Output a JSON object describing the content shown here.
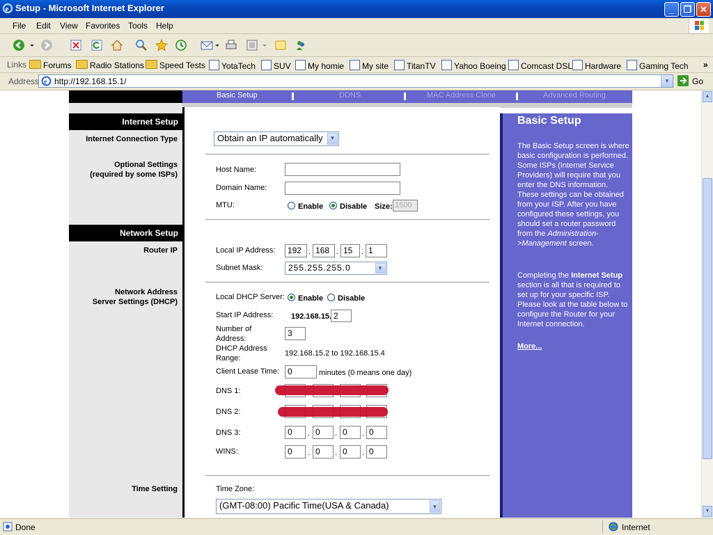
{
  "window": {
    "title": "Setup - Microsoft Internet Explorer"
  },
  "menu": [
    "File",
    "Edit",
    "View",
    "Favorites",
    "Tools",
    "Help"
  ],
  "links_bar": {
    "label": "Links",
    "items": [
      "Forums",
      "Radio Stations",
      "Speed Tests",
      "YotaTech",
      "SUV",
      "My homie",
      "My site",
      "TitanTV",
      "Yahoo Boeing",
      "Comcast DSL",
      "Hardware",
      "Gaming Tech"
    ]
  },
  "address": {
    "label": "Address",
    "url": "http://192.168.15.1/",
    "go": "Go"
  },
  "nav": {
    "basic": "Basic Setup",
    "ddns": "DDNS",
    "mac": "MAC Address Clone",
    "routing": "Advanced Routing"
  },
  "internet_setup": {
    "heading": "Internet Setup",
    "conn_type_label": "Internet Connection Type",
    "conn_type_value": "Obtain an IP automatically",
    "optional_label_1": "Optional Settings",
    "optional_label_2": "(required by some ISPs)",
    "host_name_label": "Host Name:",
    "host_name_value": "",
    "domain_name_label": "Domain Name:",
    "domain_name_value": "",
    "mtu_label": "MTU:",
    "mtu_enable": "Enable",
    "mtu_disable": "Disable",
    "mtu_size_label": "Size:",
    "mtu_size_value": "1500"
  },
  "network_setup": {
    "heading": "Network Setup",
    "router_ip_label": "Router IP",
    "local_ip_label": "Local IP Address:",
    "local_ip": [
      "192",
      "168",
      "15",
      "1"
    ],
    "subnet_label": "Subnet Mask:",
    "subnet_value": "255.255.255.0",
    "dhcp_label_1": "Network Address",
    "dhcp_label_2": "Server Settings (DHCP)",
    "dhcp_server_label": "Local DHCP Server:",
    "dhcp_enable": "Enable",
    "dhcp_disable": "Disable",
    "start_ip_label": "Start IP Address:",
    "start_ip_prefix": "192.168.15.",
    "start_ip_value": "2",
    "num_addr_label_1": "Number  of",
    "num_addr_label_2": "Address:",
    "num_addr_value": "3",
    "range_label_1": "DHCP  Address",
    "range_label_2": "Range:",
    "range_value": "192.168.15.2 to 192.168.15.4",
    "lease_label": "Client Lease Time:",
    "lease_value": "0",
    "lease_suffix": "minutes (0 means one day)",
    "dns1_label": "DNS 1:",
    "dns2_label": "DNS 2:",
    "dns3_label": "DNS 3:",
    "dns3": [
      "0",
      "0",
      "0",
      "0"
    ],
    "wins_label": "WINS:",
    "wins": [
      "0",
      "0",
      "0",
      "0"
    ]
  },
  "time_setting": {
    "label": "Time Setting",
    "tz_label": "Time Zone:",
    "tz_value": "(GMT-08:00) Pacific Time(USA & Canada)"
  },
  "help": {
    "title": "Basic Setup",
    "p1a": "The Basic Setup screen is where basic configuration is performed. Some ISPs (Internet Service Providers) will require that you enter the DNS information. These settings can be obtained from your ISP. After you have configured these settings, you should set a router password from the",
    "p1b": "Administration->Management",
    "p1c": "screen.",
    "p2a": "Completing the",
    "p2b": "Internet Setup",
    "p2c": "section is all that is required to set up for your specific ISP. Please look at the table below to configure the Router for your Internet connection.",
    "more": "More..."
  },
  "status": {
    "left": "Done",
    "zone": "Internet"
  }
}
